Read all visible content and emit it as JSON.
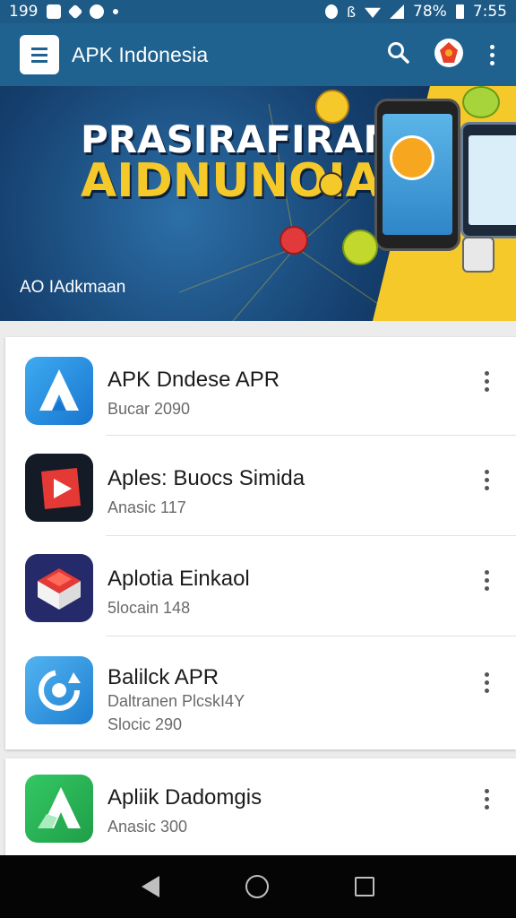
{
  "status_bar": {
    "left_text": "199",
    "battery_percent": "78%",
    "time": "7:55",
    "icons": [
      "notification-icon",
      "edit-icon",
      "chat-icon",
      "dot-icon",
      "shield-icon",
      "bluetooth-icon",
      "wifi-icon",
      "signal-icon",
      "battery-icon"
    ]
  },
  "app_bar": {
    "title": "APK Indonesia",
    "icons": [
      "app-logo-icon",
      "search-icon",
      "profile-icon",
      "more-icon"
    ]
  },
  "banner": {
    "headline_line1": "PRASIRAFIRAN",
    "headline_line2": "AIDNUNOIA",
    "caption": "AO IAdkmaan"
  },
  "list": [
    {
      "title": "APK Dndese APR",
      "subtitle": "Bucar 2090",
      "extra": "",
      "icon": "azure-a-icon",
      "colors": [
        "#2f9be9",
        "#1a78d0"
      ]
    },
    {
      "title": "Aples: Buocs Simida",
      "subtitle": "Anasic 117",
      "extra": "",
      "icon": "play-icon",
      "colors": [
        "#111827",
        "#e53935"
      ]
    },
    {
      "title": "Aplotia Einkaol",
      "subtitle": "5locain 148",
      "extra": "",
      "icon": "box-icon",
      "colors": [
        "#252a6b",
        "#e53935"
      ]
    },
    {
      "title": "Balilck APR",
      "subtitle": "Daltranen PlcskI4Y",
      "extra": "Slocic 290",
      "icon": "sync-icon",
      "colors": [
        "#3fa2ea",
        "#1e7fd1"
      ]
    },
    {
      "title": "Apliik Dadomgis",
      "subtitle": "Anasic 300",
      "extra": "",
      "icon": "green-a-icon",
      "colors": [
        "#2dbb5a",
        "#1f9e48"
      ]
    }
  ],
  "nav_bar": {
    "icons": [
      "back-icon",
      "home-icon",
      "recents-icon"
    ]
  },
  "colors": {
    "primary": "#1f628f",
    "status_bar": "#1e5a86",
    "accent_yellow": "#f6c92a"
  }
}
